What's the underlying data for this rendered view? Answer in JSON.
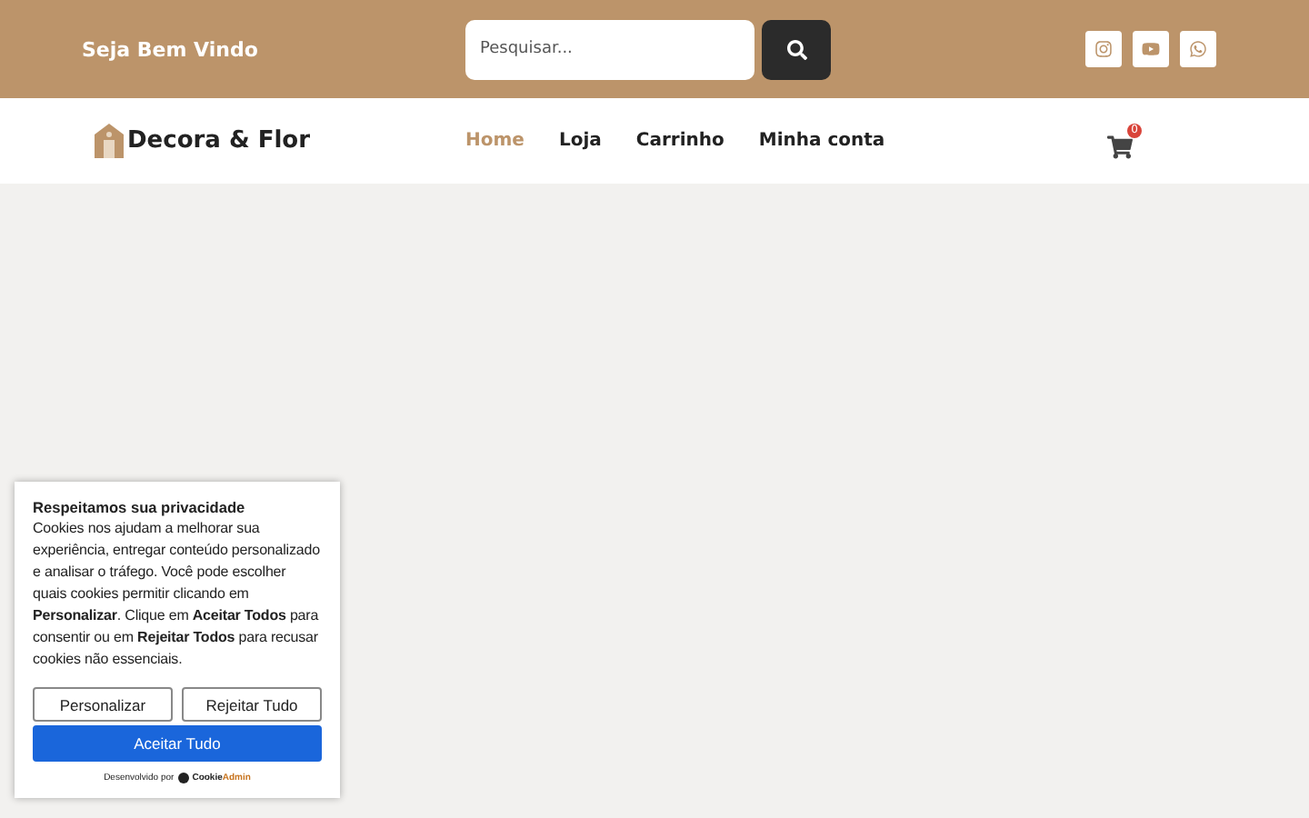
{
  "topbar": {
    "welcome": "Seja Bem Vindo",
    "search": {
      "placeholder": "Pesquisar..."
    },
    "social": [
      {
        "kind": "instagram"
      },
      {
        "kind": "youtube"
      },
      {
        "kind": "whatsapp"
      }
    ]
  },
  "header": {
    "brand": "Decora & Flor",
    "nav": [
      {
        "label": "Home",
        "selected": true
      },
      {
        "label": "Loja",
        "selected": false
      },
      {
        "label": "Carrinho",
        "selected": false
      },
      {
        "label": "Minha conta",
        "selected": false
      }
    ],
    "cart_count": "0"
  },
  "cookie_banner": {
    "title": "Respeitamos sua privacidade",
    "text": "Cookies nos ajudam a melhorar sua experiência, entregar conteúdo personalizado e analisar o tráfego. Você pode escolher quais cookies permitir clicando em **Personalizar**. Clique em **Aceitar Todos** para consentir ou em **Rejeitar Todos** para recusar cookies não essenciais.",
    "buttons": [
      {
        "label": "Personalizar",
        "kind": "secondary"
      },
      {
        "label": "Rejeitar Tudo",
        "kind": "secondary"
      },
      {
        "label": "Aceitar Tudo",
        "kind": "primary"
      }
    ],
    "powered_by": "Desenvolvido por",
    "powered_brand_1": "Cookie",
    "powered_brand_2": "Admin"
  }
}
